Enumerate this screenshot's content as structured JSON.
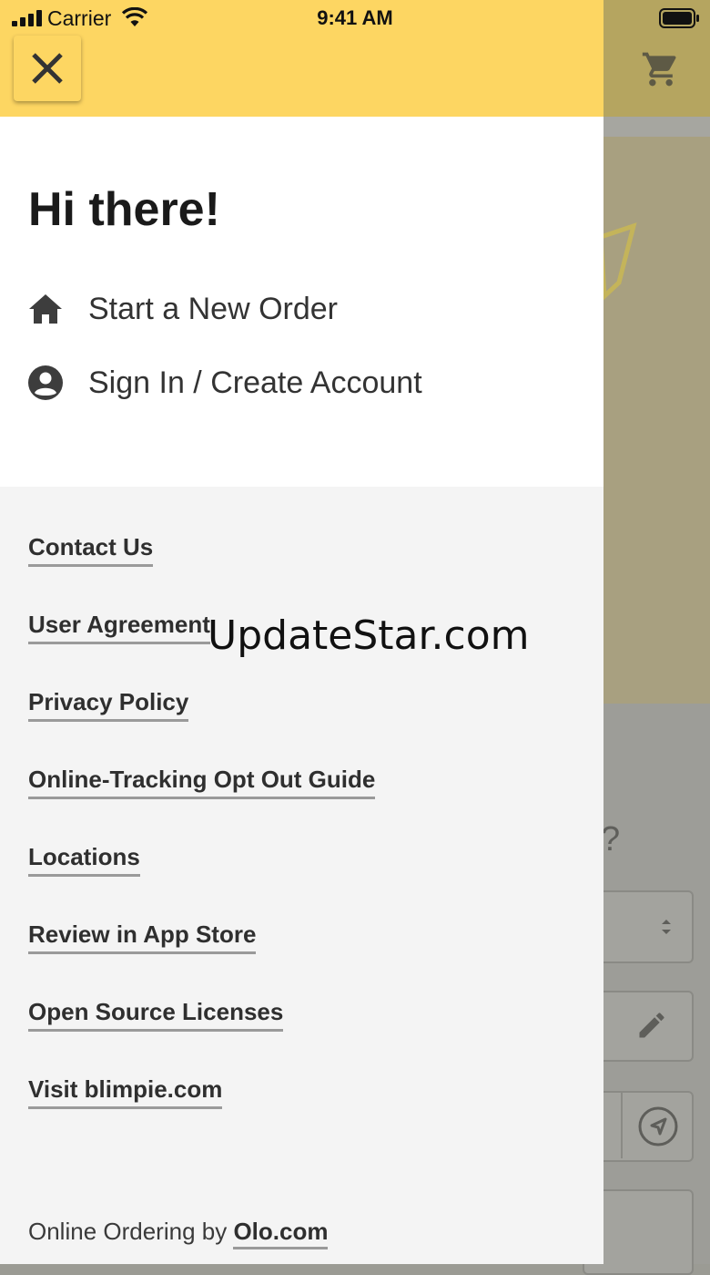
{
  "status_bar": {
    "carrier": "Carrier",
    "time": "9:41 AM"
  },
  "drawer": {
    "close_icon": "close-icon",
    "greeting": "Hi there!",
    "menu": [
      {
        "label": "Start a New Order",
        "icon": "home-icon"
      },
      {
        "label": "Sign In / Create Account",
        "icon": "account-circle-icon"
      }
    ],
    "links": [
      "Contact Us",
      "User Agreement",
      "Privacy Policy",
      "Online-Tracking Opt Out Guide",
      "Locations",
      "Review in App Store",
      "Open Source Licenses",
      "Visit blimpie.com"
    ],
    "footer": {
      "prefix": "Online Ordering by ",
      "link": "Olo.com"
    }
  },
  "background": {
    "question_mark": "?"
  },
  "watermark": "UpdateStar.com",
  "colors": {
    "header_yellow": "#fdd662",
    "drawer_bg": "#f4f4f4",
    "panel_white": "#ffffff",
    "text": "#333333"
  }
}
